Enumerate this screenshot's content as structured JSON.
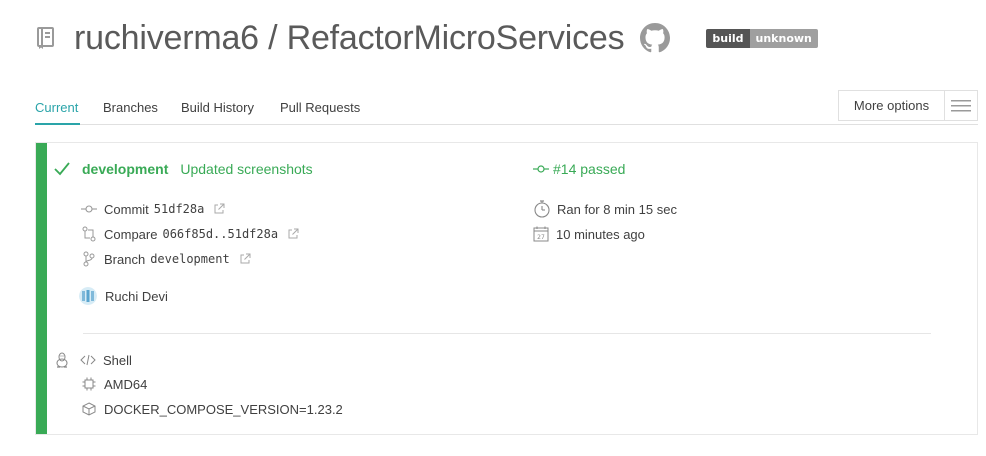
{
  "header": {
    "repo_title": "ruchiverma6 / RefactorMicroServices",
    "badge_left": "build",
    "badge_right": "unknown"
  },
  "tabs": [
    "Current",
    "Branches",
    "Build History",
    "Pull Requests"
  ],
  "more_options": {
    "label": "More options"
  },
  "build": {
    "branch": "development",
    "commit_message": "Updated screenshots",
    "build_status": "#14 passed",
    "commit_label": "Commit",
    "commit_sha": "51df28a",
    "compare_label": "Compare",
    "compare_range": "066f85d..51df28a",
    "branch_label": "Branch",
    "branch_value": "development",
    "duration": "Ran for 8 min 15 sec",
    "finished": "10 minutes ago",
    "author": "Ruchi Devi",
    "language": "Shell",
    "arch": "AMD64",
    "env_var": "DOCKER_COMPOSE_VERSION=1.23.2"
  },
  "colors": {
    "passed": "#39aa56",
    "accent": "#2aa4a9"
  },
  "icons": [
    "repo-icon",
    "github-icon",
    "hamburger-icon",
    "check-icon",
    "commit-icon",
    "compare-icon",
    "branch-icon",
    "external-link-icon",
    "stopwatch-icon",
    "calendar-icon",
    "linux-icon",
    "code-icon",
    "chip-icon",
    "box-icon"
  ]
}
